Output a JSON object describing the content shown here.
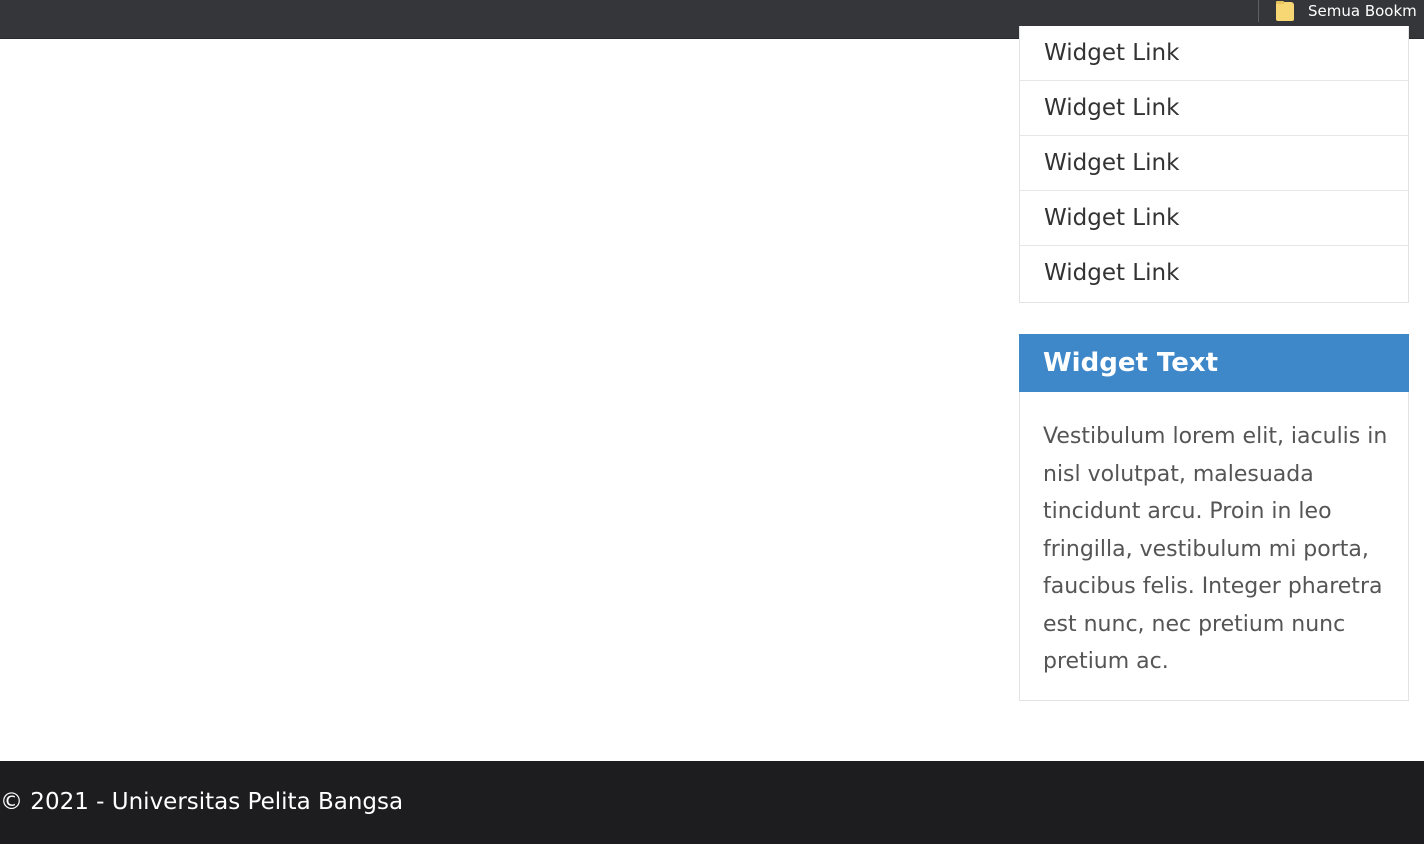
{
  "browser": {
    "bookmarks_bar": {
      "folder_label": "Semua Bookm",
      "folder_icon": "folder-icon"
    }
  },
  "sidebar": {
    "widget_links": [
      {
        "label": "Widget Link"
      },
      {
        "label": "Widget Link"
      },
      {
        "label": "Widget Link"
      },
      {
        "label": "Widget Link"
      },
      {
        "label": "Widget Link"
      }
    ],
    "widget_text": {
      "title": "Widget Text",
      "body": "Vestibulum lorem elit, iaculis in nisl volutpat, malesuada tincidunt arcu. Proin in leo fringilla, vestibulum mi porta, faucibus felis. Integer pharetra est nunc, nec pretium nunc pretium ac."
    }
  },
  "footer": {
    "copyright": "© 2021 - Universitas Pelita Bangsa"
  },
  "colors": {
    "widget_header": "#3e87c8",
    "footer_bg": "#1d1d1f",
    "bookmarks_bar_bg": "#35363a"
  }
}
